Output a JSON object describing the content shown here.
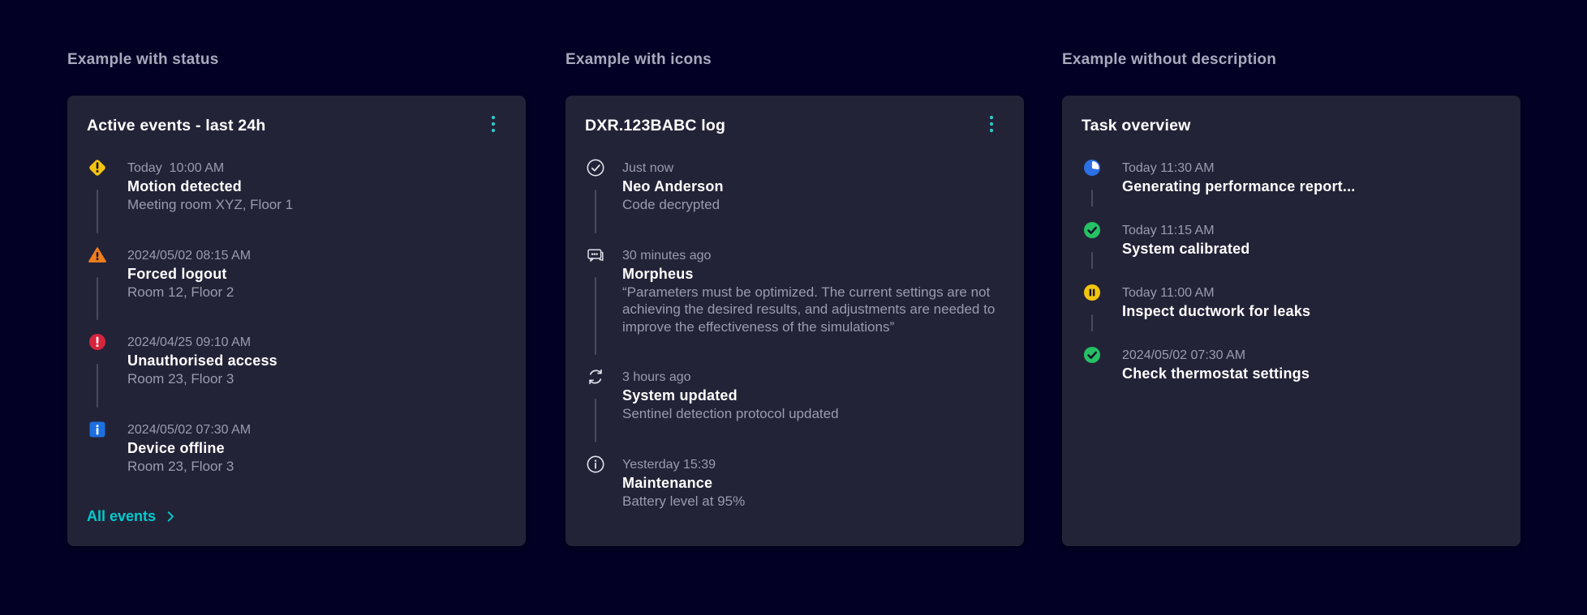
{
  "colors": {
    "page_bg": "#020024",
    "card_bg": "#232338",
    "title_text": "#FFFFFF",
    "soft_text": "#9B9BAF",
    "section_label_text": "#A9A9BD",
    "connector": "#494960",
    "accent_teal": "#00CCCC",
    "status_warning_yellow": "#F2C40E",
    "status_caution_orange": "#EE7D1E",
    "status_alarm_red": "#D6243C",
    "status_info_blue": "#1D6FE0",
    "status_progress_blue": "#2B70E4",
    "status_success_green": "#25C164",
    "status_paused_yellow": "#F2C40E",
    "outline_icon": "#E2E2EC"
  },
  "sections": [
    {
      "label": "Example with status"
    },
    {
      "label": "Example with icons"
    },
    {
      "label": "Example without description"
    }
  ],
  "cards": [
    {
      "title": "Active events - last 24h",
      "menu": true,
      "menu_icon": "kebab-menu-icon",
      "footer_link": "All events",
      "footer_icon": "chevron-right-icon",
      "items": [
        {
          "icon": "warning-diamond",
          "timestamp": "Today  10:00 AM",
          "title": "Motion detected",
          "description": "Meeting room XYZ, Floor 1"
        },
        {
          "icon": "warning-triangle",
          "timestamp": "2024/05/02 08:15 AM",
          "title": "Forced logout",
          "description": "Room 12, Floor 2"
        },
        {
          "icon": "error-circle",
          "timestamp": "2024/04/25 09:10 AM",
          "title": "Unauthorised access",
          "description": "Room 23, Floor 3"
        },
        {
          "icon": "info-square",
          "timestamp": "2024/05/02 07:30 AM",
          "title": "Device offline",
          "description": "Room 23, Floor 3"
        }
      ]
    },
    {
      "title": "DXR.123BABC log",
      "menu": true,
      "menu_icon": "kebab-menu-icon",
      "items": [
        {
          "icon": "check-circle",
          "timestamp": "Just now",
          "title": "Neo Anderson",
          "description": "Code decrypted"
        },
        {
          "icon": "chat",
          "timestamp": "30 minutes ago",
          "title": "Morpheus",
          "description": "“Parameters must be optimized. The current settings are not achieving the desired results, and adjustments are needed to improve the effectiveness of the simulations”"
        },
        {
          "icon": "sync",
          "timestamp": "3 hours ago",
          "title": "System updated",
          "description": "Sentinel detection protocol updated"
        },
        {
          "icon": "info-circle",
          "timestamp": "Yesterday 15:39",
          "title": "Maintenance",
          "description": "Battery level at 95%"
        }
      ]
    },
    {
      "title": "Task overview",
      "menu": false,
      "items": [
        {
          "icon": "in-progress",
          "timestamp": "Today 11:30 AM",
          "title": "Generating performance report..."
        },
        {
          "icon": "success",
          "timestamp": "Today 11:15 AM",
          "title": "System calibrated"
        },
        {
          "icon": "paused",
          "timestamp": "Today 11:00 AM",
          "title": "Inspect ductwork for leaks"
        },
        {
          "icon": "success",
          "timestamp": "2024/05/02 07:30 AM",
          "title": "Check thermostat settings"
        }
      ]
    }
  ]
}
